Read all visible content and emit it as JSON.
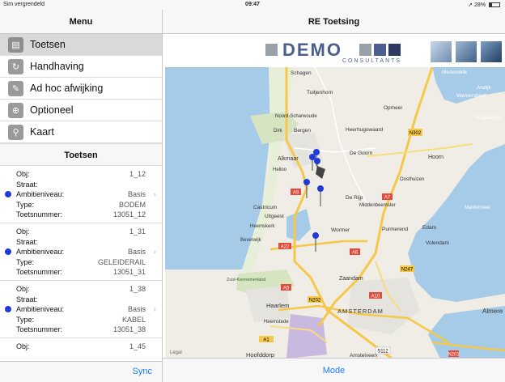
{
  "status": {
    "carrier": "Sim vergrendeld",
    "time": "09:47",
    "battery": "28%"
  },
  "menu": {
    "title": "Menu",
    "items": [
      {
        "label": "Toetsen",
        "icon": "checklist-icon",
        "selected": true
      },
      {
        "label": "Handhaving",
        "icon": "enforcement-icon",
        "selected": false
      },
      {
        "label": "Ad hoc afwijking",
        "icon": "pencil-icon",
        "selected": false
      },
      {
        "label": "Optioneel",
        "icon": "magnifier-plus-icon",
        "selected": false
      },
      {
        "label": "Kaart",
        "icon": "map-pin-icon",
        "selected": false
      }
    ]
  },
  "list": {
    "title": "Toetsen",
    "labels": {
      "obj": "Obj:",
      "straat": "Straat:",
      "ambitie": "Ambitieniveau:",
      "type": "Type:",
      "nummer": "Toetsnummer:"
    },
    "records": [
      {
        "obj": "1_12",
        "straat": "",
        "ambitie": "Basis",
        "type": "BODEM",
        "nummer": "13051_12"
      },
      {
        "obj": "1_31",
        "straat": "",
        "ambitie": "Basis",
        "type": "GELEIDERAIL",
        "nummer": "13051_31"
      },
      {
        "obj": "1_38",
        "straat": "",
        "ambitie": "Basis",
        "type": "KABEL",
        "nummer": "13051_38"
      },
      {
        "obj": "1_45"
      }
    ],
    "sync_label": "Sync"
  },
  "detail": {
    "title": "RE Toetsing",
    "logo_text": "DEMO",
    "logo_sub": "CONSULTANTS",
    "mode_label": "Mode",
    "map_legal": "Legal"
  },
  "map": {
    "places": [
      "Schagen",
      "Tuitjenhorn",
      "Medemblik",
      "Andijk",
      "Wervershoof",
      "Noord-Scharwoude",
      "Opmeer",
      "Hoogkarspel",
      "Dirk",
      "Bergen",
      "Heerhugowaard",
      "Alkmaar",
      "De Goorn",
      "Hoorn",
      "Heiloo",
      "Oosthuizen",
      "Castricum",
      "De Rijp",
      "Middenbeemster",
      "Uitgeest",
      "Heemskerk",
      "Wormer",
      "Purmerend",
      "Edam",
      "Beverwijk",
      "Volendam",
      "Zuid-Kennemerland",
      "Zaandam",
      "Haarlem",
      "AMSTERDAM",
      "Heemstede",
      "Almere",
      "Hoofddorp",
      "Amstelveen",
      "Markermeer"
    ],
    "roads": [
      "N302",
      "A9",
      "A7",
      "A8",
      "A22",
      "N247",
      "N202",
      "A10",
      "A5",
      "A1",
      "N201",
      "S112"
    ]
  },
  "colors": {
    "accent": "#1a7cf5",
    "pin": "#1f3ad6",
    "logo": "#4a5f8d",
    "land": "#f0ede6",
    "water": "#a6cbe8",
    "road": "#f5c84a"
  }
}
